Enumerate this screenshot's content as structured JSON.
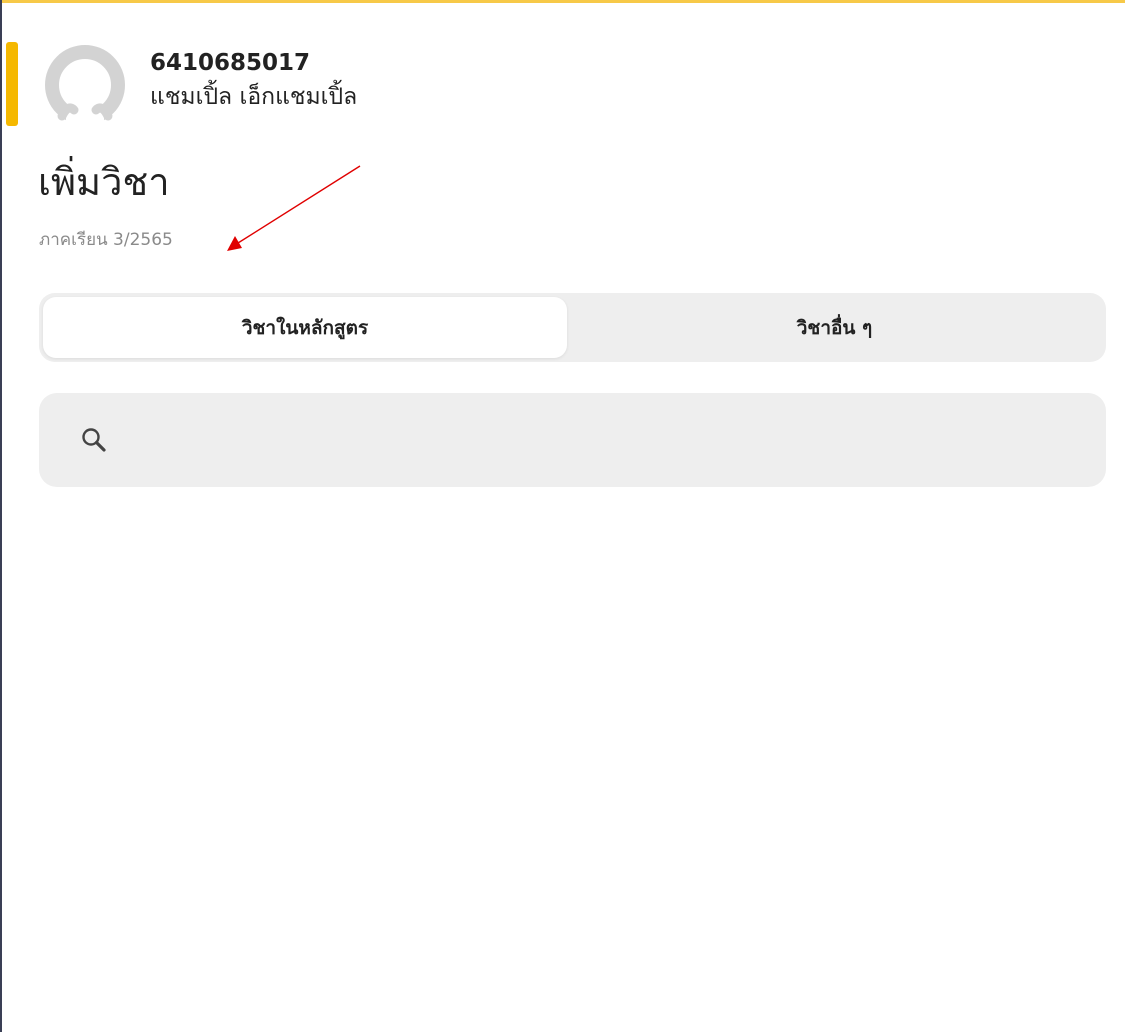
{
  "colors": {
    "accent": "#f5b800",
    "top_border": "#f7c948",
    "panel_bg": "#eeeeee",
    "annotation": "#e00000"
  },
  "profile": {
    "student_id": "6410685017",
    "name": "แชมเปิ้ล เอ็กแชมเปิ้ล",
    "avatar_icon": "user-avatar-icon"
  },
  "page": {
    "title": "เพิ่มวิชา",
    "semester": "ภาคเรียน 3/2565"
  },
  "tabs": [
    {
      "label": "วิชาในหลักสูตร",
      "selected": true
    },
    {
      "label": "วิชาอื่น ๆ",
      "selected": false
    }
  ],
  "search": {
    "icon": "search-icon",
    "placeholder": "",
    "value": ""
  }
}
